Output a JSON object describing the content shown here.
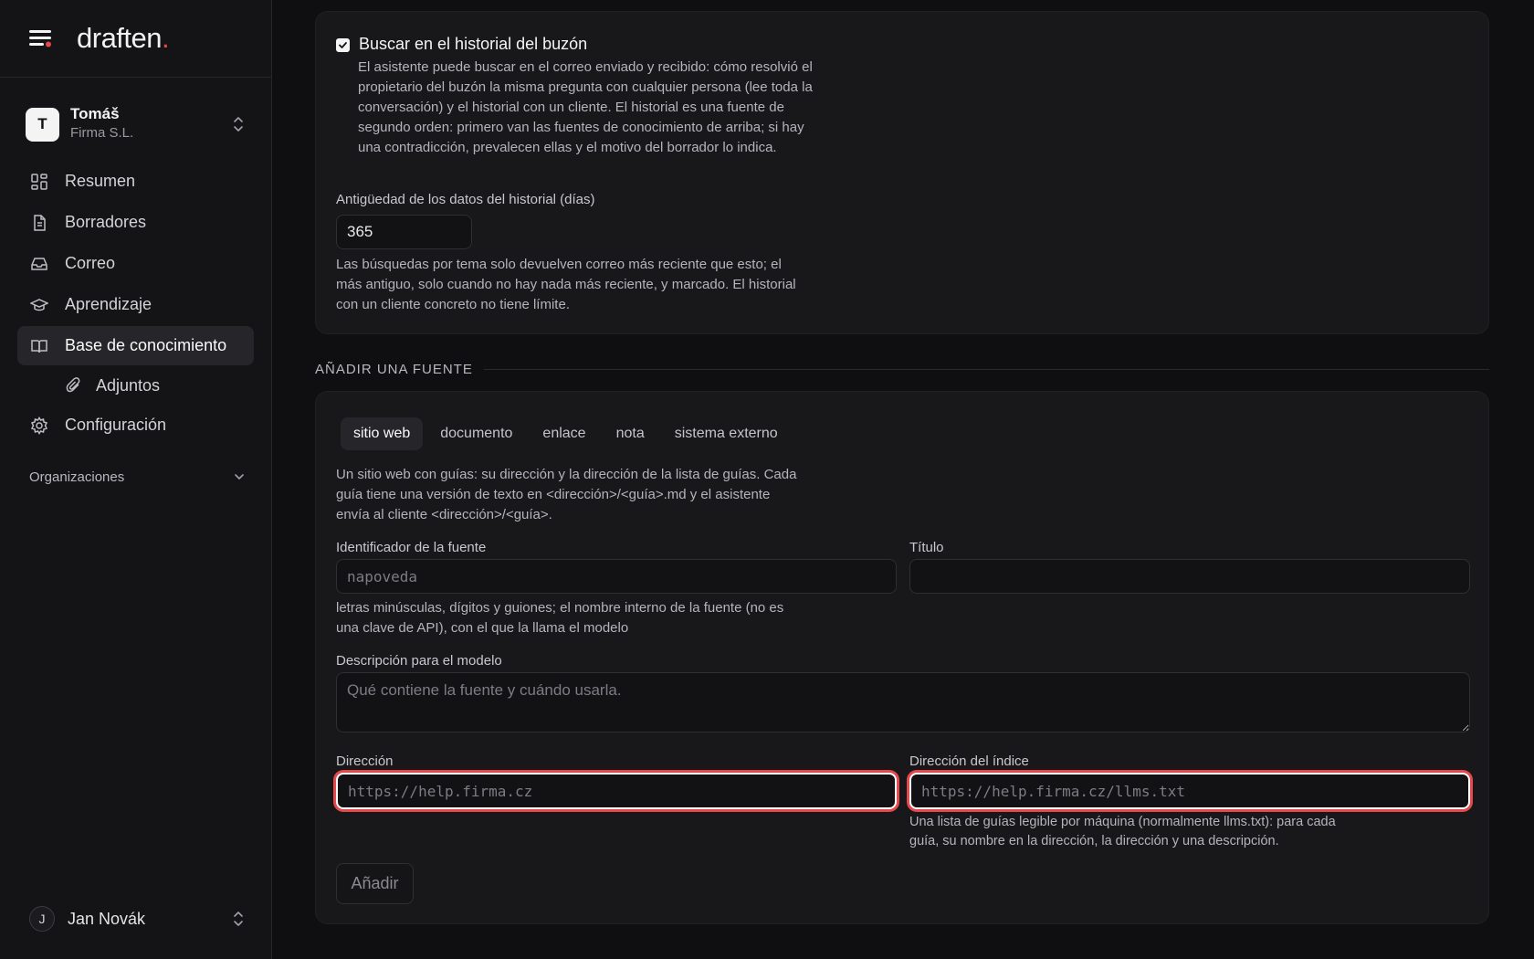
{
  "brand": {
    "logo_text": "draften",
    "logo_dot": "."
  },
  "org": {
    "avatar_letter": "T",
    "name": "Tomáš",
    "company": "Firma S.L."
  },
  "nav": {
    "items": [
      {
        "label": "Resumen"
      },
      {
        "label": "Borradores"
      },
      {
        "label": "Correo"
      },
      {
        "label": "Aprendizaje"
      },
      {
        "label": "Base de conocimiento"
      },
      {
        "label": "Adjuntos"
      },
      {
        "label": "Configuración"
      }
    ],
    "section_label": "Organizaciones"
  },
  "user": {
    "avatar_letter": "J",
    "name": "Jan Novák"
  },
  "history": {
    "checkbox_label": "Buscar en el historial del buzón",
    "checked": true,
    "description": "El asistente puede buscar en el correo enviado y recibido: cómo resolvió el propietario del buzón la misma pregunta con cualquier persona (lee toda la conversación) y el historial con un cliente. El historial es una fuente de segundo orden: primero van las fuentes de conocimiento de arriba; si hay una contradicción, prevalecen ellas y el motivo del borrador lo indica.",
    "age_label": "Antigüedad de los datos del historial (días)",
    "age_value": "365",
    "age_hint": "Las búsquedas por tema solo devuelven correo más reciente que esto; el más antiguo, solo cuando no hay nada más reciente, y marcado. El historial con un cliente concreto no tiene límite."
  },
  "add_source": {
    "section_title": "AÑADIR UNA FUENTE",
    "tabs": [
      "sitio web",
      "documento",
      "enlace",
      "nota",
      "sistema externo"
    ],
    "active_tab": "sitio web",
    "intro": "Un sitio web con guías: su dirección y la dirección de la lista de guías. Cada guía tiene una versión de texto en <dirección>/<guía>.md y el asistente envía al cliente <dirección>/<guía>.",
    "id_label": "Identificador de la fuente",
    "id_placeholder": "napoveda",
    "id_hint": "letras minúsculas, dígitos y guiones; el nombre interno de la fuente (no es una clave de API), con el que la llama el modelo",
    "title_label": "Título",
    "title_value": "",
    "desc_label": "Descripción para el modelo",
    "desc_placeholder": "Qué contiene la fuente y cuándo usarla.",
    "address_label": "Dirección",
    "address_placeholder": "https://help.firma.cz",
    "index_label": "Dirección del índice",
    "index_placeholder": "https://help.firma.cz/llms.txt",
    "index_hint": "Una lista de guías legible por máquina (normalmente llms.txt): para cada guía, su nombre en la dirección, la dirección y una descripción.",
    "submit_label": "Añadir"
  },
  "colors": {
    "accent_dot": "#e5484d",
    "focus_ring": "#e5484d",
    "background": "#0f0f11",
    "card": "#18181b"
  }
}
